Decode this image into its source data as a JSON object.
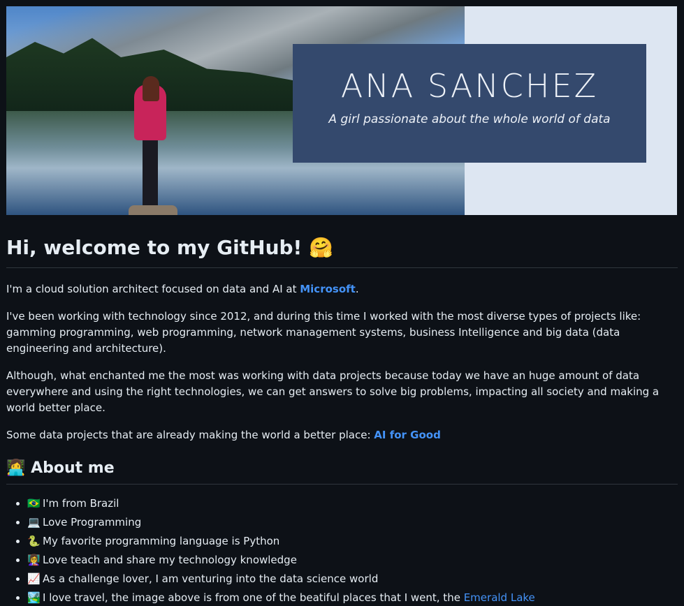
{
  "banner": {
    "name": "ANA SANCHEZ",
    "tagline": "A girl passionate about the whole world of data",
    "box_color": "#34496d",
    "panel_color": "#dde6f2"
  },
  "heading": {
    "text": "Hi, welcome to my GitHub!",
    "emoji": "🤗"
  },
  "intro": {
    "p1_text": "I'm a cloud solution architect focused on data and AI at ",
    "p1_link": "Microsoft",
    "p1_end": ".",
    "p2": "I've been working with technology since 2012, and during this time I worked with the most diverse types of projects like: gamming programming, web programming, network management systems, business Intelligence and big data (data engineering and architecture).",
    "p3": "Although, what enchanted me the most was working with data projects because today we have an huge amount of data everywhere and using the right technologies, we can get answers to solve big problems, impacting all society and making a world better place.",
    "p4_text": "Some data projects that are already making the world a better place: ",
    "p4_link": "AI for Good"
  },
  "about": {
    "emoji": "👩‍💻",
    "title": "About me",
    "items": [
      {
        "emoji": "🇧🇷",
        "text": "I'm from Brazil"
      },
      {
        "emoji": "💻",
        "text": "Love Programming"
      },
      {
        "emoji": "🐍",
        "text": "My favorite programming language is Python"
      },
      {
        "emoji": "👩‍🏫",
        "text": "Love teach and share my technology knowledge"
      },
      {
        "emoji": "📈",
        "text": "As a challenge lover, I am venturing into the data science world"
      },
      {
        "emoji": "🏞️",
        "text": "I love travel, the image above is from one of the beatiful places that I went, the ",
        "link": "Emerald Lake"
      }
    ]
  },
  "colors": {
    "background": "#0d1117",
    "text": "#e6edf3",
    "link": "#4493f8",
    "border": "#30363d"
  }
}
